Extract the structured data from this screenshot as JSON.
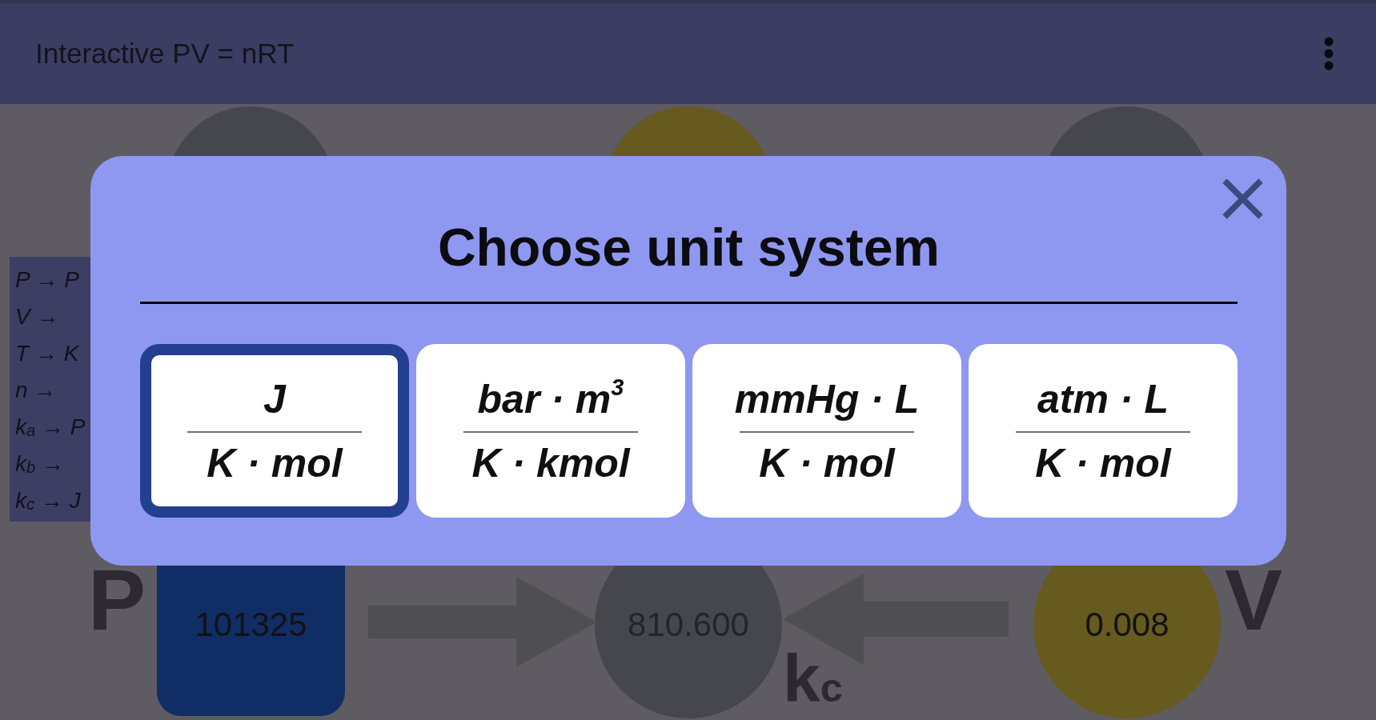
{
  "app_bar": {
    "title": "Interactive PV = nRT"
  },
  "diagram": {
    "top_nodes": [
      {
        "kind": "constant"
      },
      {
        "kind": "variable"
      },
      {
        "kind": "constant"
      }
    ],
    "legend": [
      "P → P",
      "V →",
      "T → K",
      "n →",
      "k$_{a}$ → P",
      "k$_{b}$ →",
      "k$_{c}$ → J"
    ],
    "bottom_nodes": [
      {
        "kind": "input",
        "value": "101325"
      },
      {
        "kind": "constant",
        "value": "810.600"
      },
      {
        "kind": "variable",
        "value": "0.008"
      }
    ],
    "symbols": [
      "P",
      "k$_{c}$",
      "V"
    ]
  },
  "dialog": {
    "title": "Choose unit system",
    "options": [
      {
        "numerator": "J",
        "denominator": "K · mol",
        "selected": true
      },
      {
        "numerator": "bar · m$^{3}$",
        "denominator": "K · kmol",
        "selected": false
      },
      {
        "numerator": "mmHg · L",
        "denominator": "K · mol",
        "selected": false
      },
      {
        "numerator": "atm · L",
        "denominator": "K · mol",
        "selected": false
      }
    ]
  }
}
